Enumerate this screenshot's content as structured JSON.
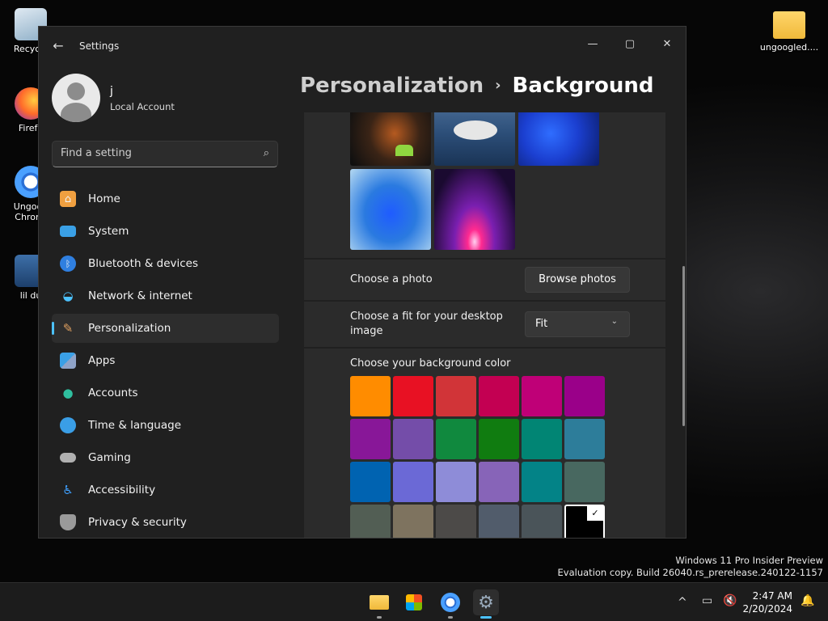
{
  "desktop": {
    "icons": [
      {
        "label": "Recycle"
      },
      {
        "label": "Firefo"
      },
      {
        "label": "Ungoog Chromi"
      },
      {
        "label": "lil du"
      },
      {
        "label": "ungoogled...."
      }
    ],
    "watermark": {
      "line1": "Windows 11 Pro Insider Preview",
      "line2": "Evaluation copy. Build 26040.rs_prerelease.240122-1157"
    }
  },
  "window": {
    "title": "Settings",
    "controls": {
      "minimize": "—",
      "maximize": "▢",
      "close": "✕"
    }
  },
  "user": {
    "name": "j",
    "account_type": "Local Account"
  },
  "search": {
    "placeholder": "Find a setting"
  },
  "nav": {
    "items": [
      {
        "label": "Home",
        "icon": "home-icon",
        "color": "#f0a040"
      },
      {
        "label": "System",
        "icon": "monitor-icon",
        "color": "#3aa0e6"
      },
      {
        "label": "Bluetooth & devices",
        "icon": "bluetooth-icon",
        "color": "#2f7fe0"
      },
      {
        "label": "Network & internet",
        "icon": "wifi-icon",
        "color": "#4cc2ff"
      },
      {
        "label": "Personalization",
        "icon": "brush-icon",
        "color": "#e0a060",
        "active": true
      },
      {
        "label": "Apps",
        "icon": "apps-icon",
        "color": "#8fa3c8"
      },
      {
        "label": "Accounts",
        "icon": "person-icon",
        "color": "#2fbf9f"
      },
      {
        "label": "Time & language",
        "icon": "globe-clock-icon",
        "color": "#3a9ee6"
      },
      {
        "label": "Gaming",
        "icon": "gamepad-icon",
        "color": "#b0b0b0"
      },
      {
        "label": "Accessibility",
        "icon": "accessibility-icon",
        "color": "#3fa0ff"
      },
      {
        "label": "Privacy & security",
        "icon": "shield-icon",
        "color": "#9a9a9a"
      }
    ]
  },
  "breadcrumb": {
    "parent": "Personalization",
    "separator": "›",
    "current": "Background"
  },
  "settings": {
    "choose_photo": {
      "label": "Choose a photo",
      "button": "Browse photos"
    },
    "choose_fit": {
      "label": "Choose a fit for your desktop image",
      "value": "Fit"
    },
    "bg_color": {
      "label": "Choose your background color",
      "colors": [
        "#FF8C00",
        "#E81123",
        "#D13438",
        "#C30052",
        "#BF0077",
        "#9A0089",
        "#881798",
        "#744DA9",
        "#10893E",
        "#107C10",
        "#018574",
        "#2D7D9A",
        "#0063B1",
        "#6B69D6",
        "#8E8CD8",
        "#8764B8",
        "#038387",
        "#486860",
        "#525E54",
        "#7E735F",
        "#4C4A48",
        "#515C6B",
        "#4A5459",
        "#000000"
      ],
      "selected_index": 23
    }
  },
  "taskbar": {
    "apps": [
      {
        "icon": "file-explorer-icon"
      },
      {
        "icon": "store-icon"
      },
      {
        "icon": "chromium-icon"
      },
      {
        "icon": "settings-icon"
      }
    ],
    "tray": {
      "chevron": "^",
      "time": "2:47 AM",
      "date": "2/20/2024"
    }
  }
}
